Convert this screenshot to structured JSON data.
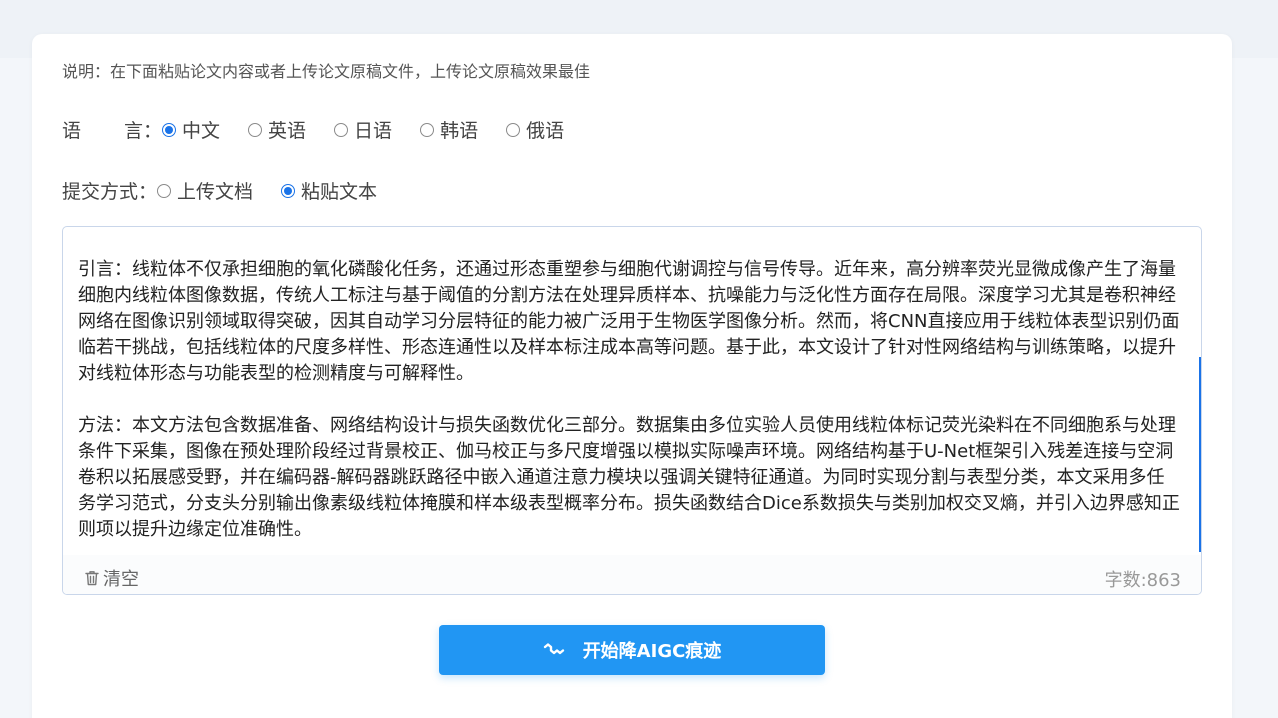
{
  "instructions": "说明：在下面粘贴论文内容或者上传论文原稿文件，上传论文原稿效果最佳",
  "language": {
    "label_first": "语",
    "label_last": "言：",
    "options": [
      "中文",
      "英语",
      "日语",
      "韩语",
      "俄语"
    ],
    "selected": "中文"
  },
  "submit_mode": {
    "label": "提交方式：",
    "options": [
      "上传文档",
      "粘贴文本"
    ],
    "selected": "粘贴文本"
  },
  "editor": {
    "text": "引言：线粒体不仅承担细胞的氧化磷酸化任务，还通过形态重塑参与细胞代谢调控与信号传导。近年来，高分辨率荧光显微成像产生了海量细胞内线粒体图像数据，传统人工标注与基于阈值的分割方法在处理异质样本、抗噪能力与泛化性方面存在局限。深度学习尤其是卷积神经网络在图像识别领域取得突破，因其自动学习分层特征的能力被广泛用于生物医学图像分析。然而，将CNN直接应用于线粒体表型识别仍面临若干挑战，包括线粒体的尺度多样性、形态连通性以及样本标注成本高等问题。基于此，本文设计了针对性网络结构与训练策略，以提升对线粒体形态与功能表型的检测精度与可解释性。\n\n方法：本文方法包含数据准备、网络结构设计与损失函数优化三部分。数据集由多位实验人员使用线粒体标记荧光染料在不同细胞系与处理条件下采集，图像在预处理阶段经过背景校正、伽马校正与多尺度增强以模拟实际噪声环境。网络结构基于U-Net框架引入残差连接与空洞卷积以拓展感受野，并在编码器-解码器跳跃路径中嵌入通道注意力模块以强调关键特征通道。为同时实现分割与表型分类，本文采用多任务学习范式，分支头分别输出像素级线粒体掩膜和样本级表型概率分布。损失函数结合Dice系数损失与类别加权交叉熵，并引入边界感知正则项以提升边缘定位准确性。",
    "clear_label": "清空",
    "count_label": "字数:863"
  },
  "submit_button": {
    "label": "开始降AIGC痕迹"
  },
  "colors": {
    "accent": "#2196f3",
    "radio_on": "#1a73e8"
  }
}
